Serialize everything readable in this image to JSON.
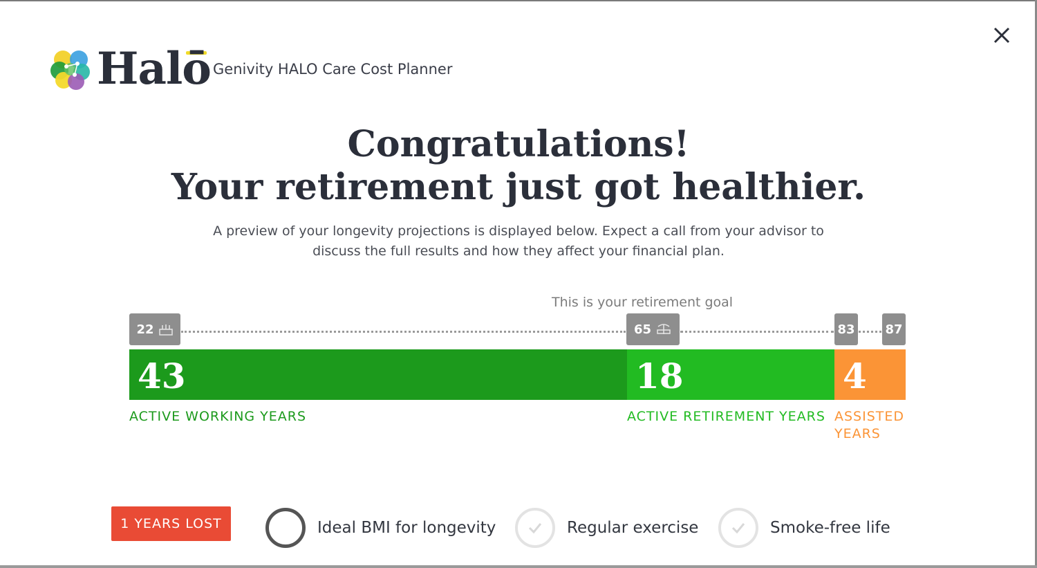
{
  "header": {
    "logo_text": "Halō",
    "app_title": "Genivity HALO Care Cost Planner"
  },
  "headline": {
    "line1": "Congratulations!",
    "line2": "Your retirement just got healthier."
  },
  "subtext": "A preview of your longevity projections is displayed below. Expect a call from your advisor to discuss the full results and how they affect your financial plan.",
  "timeline": {
    "goal_label": "This is your retirement goal",
    "ages": {
      "current": "22",
      "retirement": "65",
      "active_end": "83",
      "life_end": "87"
    },
    "icons": {
      "current": "birthday-cake-icon",
      "retirement": "beach-chair-icon"
    }
  },
  "chart_data": {
    "type": "bar",
    "orientation": "horizontal-stacked",
    "categories": [
      "ACTIVE WORKING YEARS",
      "ACTIVE RETIREMENT YEARS",
      "ASSISTED YEARS"
    ],
    "values": [
      43,
      18,
      4
    ],
    "age_marks": [
      22,
      65,
      83,
      87
    ],
    "colors": [
      "#1c9a1c",
      "#22bb22",
      "#fb9436"
    ]
  },
  "segments": {
    "working": {
      "value": "43",
      "label": "ACTIVE WORKING YEARS"
    },
    "retirement": {
      "value": "18",
      "label": "ACTIVE RETIREMENT YEARS"
    },
    "assisted": {
      "value": "4",
      "label": "ASSISTED YEARS"
    }
  },
  "badge": {
    "text": "1 YEARS LOST",
    "color": "#e94b35"
  },
  "factors": [
    {
      "label": "Ideal BMI for longevity",
      "state": "unchecked"
    },
    {
      "label": "Regular exercise",
      "state": "checked"
    },
    {
      "label": "Smoke-free life",
      "state": "checked"
    }
  ],
  "colors": {
    "text_dark": "#2b2f3a",
    "working": "#1c9a1c",
    "retirement": "#22bb22",
    "assisted": "#fb9436",
    "tag_gray": "#8e8e8e"
  }
}
